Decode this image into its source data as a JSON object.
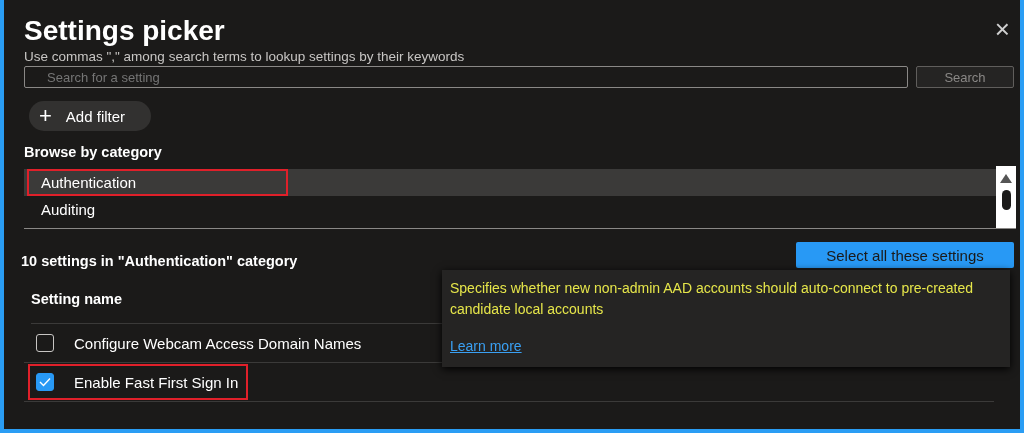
{
  "dialog": {
    "title": "Settings picker",
    "subtitle": "Use commas \",\" among search terms to lookup settings by their keywords",
    "close": "×"
  },
  "search": {
    "placeholder": "Search for a setting",
    "button": "Search"
  },
  "add_filter": {
    "icon": "+",
    "label": "Add filter"
  },
  "browse": {
    "heading": "Browse by category",
    "categories": [
      {
        "label": "Authentication",
        "selected": true,
        "highlighted": true
      },
      {
        "label": "Auditing",
        "selected": false,
        "highlighted": false
      }
    ]
  },
  "settings": {
    "summary": "10 settings in \"Authentication\" category",
    "select_all": "Select all these settings",
    "column": "Setting name",
    "rows": [
      {
        "label": "Configure Webcam Access Domain Names",
        "checked": false,
        "highlighted": false
      },
      {
        "label": "Enable Fast First Sign In",
        "checked": true,
        "highlighted": true
      }
    ]
  },
  "tooltip": {
    "text": "Specifies whether new non-admin AAD accounts should auto-connect to pre-created candidate local accounts",
    "link": "Learn more"
  }
}
